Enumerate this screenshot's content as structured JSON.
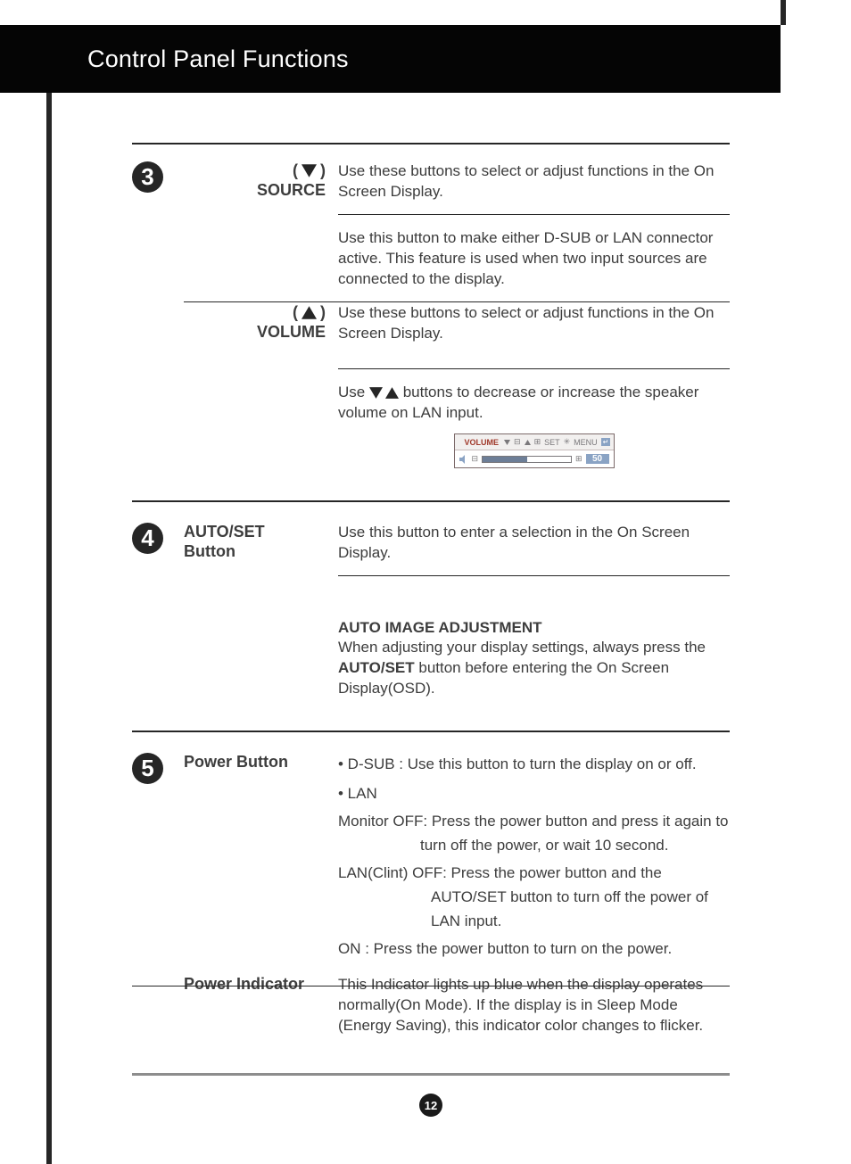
{
  "header": {
    "title": "Control Panel Functions"
  },
  "page_number": "12",
  "section3": {
    "num": "3",
    "source_label_top": "(    )",
    "source_label_bot": "SOURCE",
    "source_desc1": "Use these buttons to select or adjust functions in the On Screen Display.",
    "source_desc2": "Use this button to make either D-SUB or LAN connector active. This feature is used when two input sources are connected to the display.",
    "volume_label_top": "(    )",
    "volume_label_bot": "VOLUME",
    "volume_desc1": "Use these buttons to select or adjust functions in the On Screen Display.",
    "volume_desc2a": "Use ",
    "volume_desc2b": " buttons to decrease or increase the speaker volume on LAN input.",
    "osd": {
      "title": "VOLUME",
      "set": "SET",
      "menu": "MENU",
      "value": "50"
    }
  },
  "section4": {
    "num": "4",
    "label1": "AUTO/SET",
    "label2": "Button",
    "desc1": "Use this button to enter a selection in the On Screen Display.",
    "auto_head": "AUTO IMAGE ADJUSTMENT",
    "auto_body1": "When adjusting your display settings, always press the ",
    "auto_bold": "AUTO/SET",
    "auto_body2": " button before entering the On Screen Display(OSD)."
  },
  "section5": {
    "num": "5",
    "power_label": "Power Button",
    "dsub": "• D-SUB : Use this button to turn the display on or off.",
    "lan": "• LAN",
    "mon_off": "Monitor OFF: Press the power button and press it again to turn off the power, or wait 10 second.",
    "lan_off": "LAN(Clint) OFF: Press the power button and the AUTO/SET button to turn off the power of LAN input.",
    "on": "ON : Press the power button to turn on the power.",
    "indicator_label": "Power Indicator",
    "indicator_desc": "This Indicator lights up blue when the display operates normally(On Mode). If the display is in Sleep Mode (Energy Saving), this indicator color changes to flicker."
  }
}
